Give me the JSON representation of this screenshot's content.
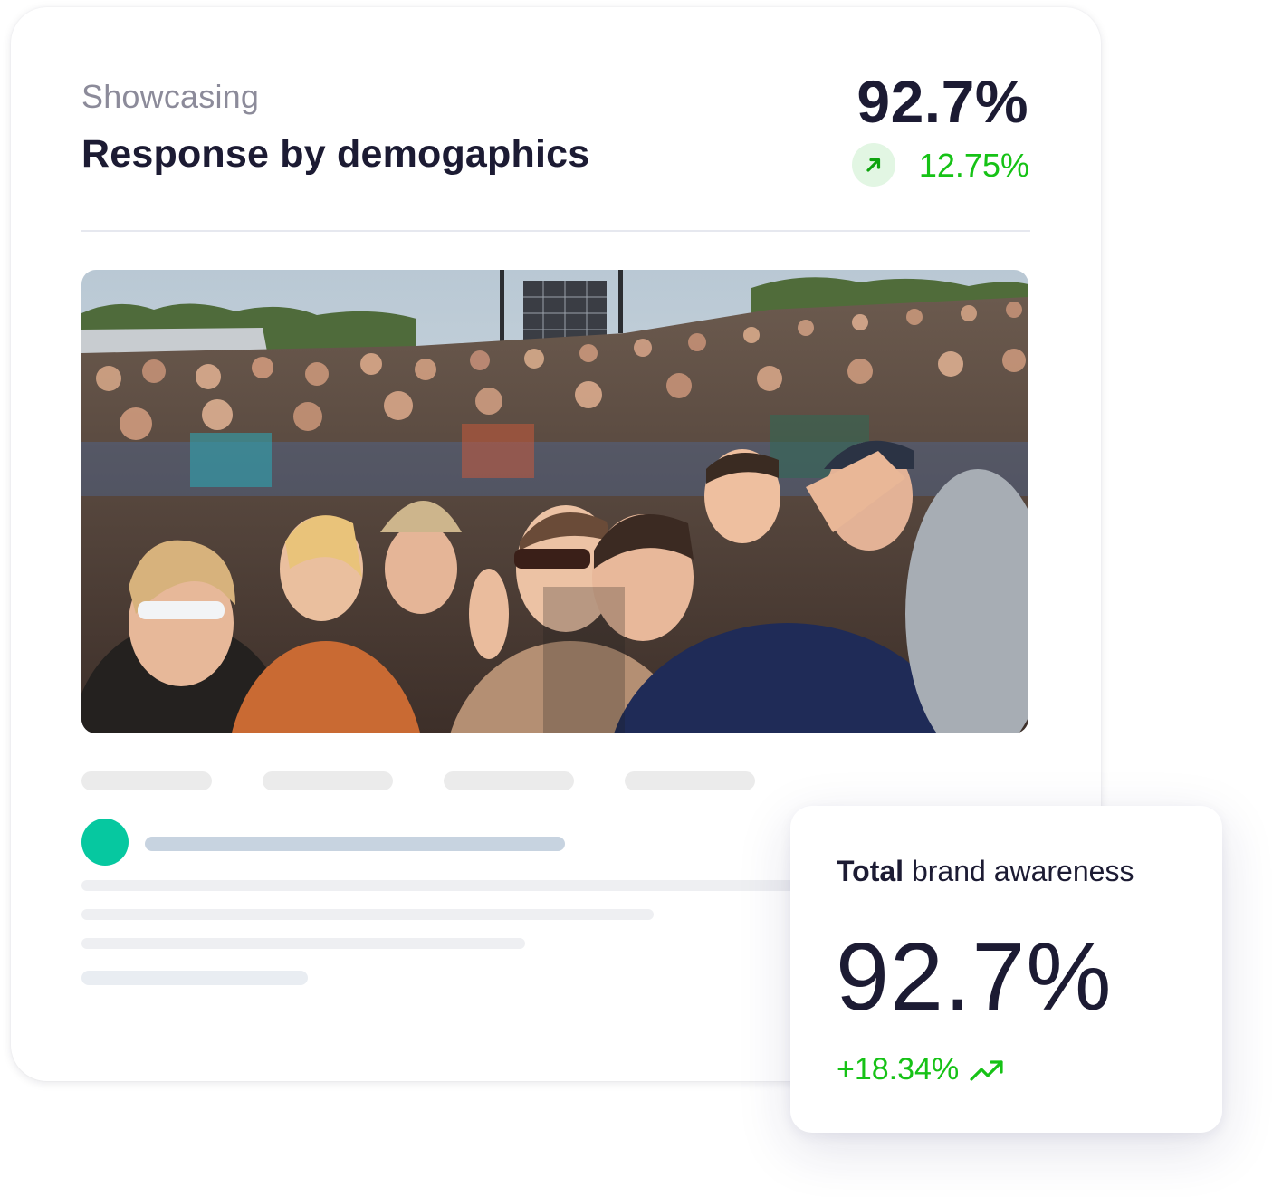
{
  "header": {
    "eyebrow": "Showcasing",
    "title": "Response by demogaphics",
    "metric_value": "92.7%",
    "metric_change": "12.75%",
    "trend_icon": "arrow-up-right-icon"
  },
  "hero": {
    "image_icon": "crowd-photo"
  },
  "colors": {
    "accent_green": "#16c216",
    "badge_bg": "#e2f6e3",
    "avatar": "#06c8a0",
    "text_dark": "#1c1b33"
  },
  "awareness_card": {
    "label_bold": "Total",
    "label_rest": " brand awareness",
    "value": "92.7%",
    "change": "+18.34%",
    "trend_icon": "trending-up-icon"
  }
}
